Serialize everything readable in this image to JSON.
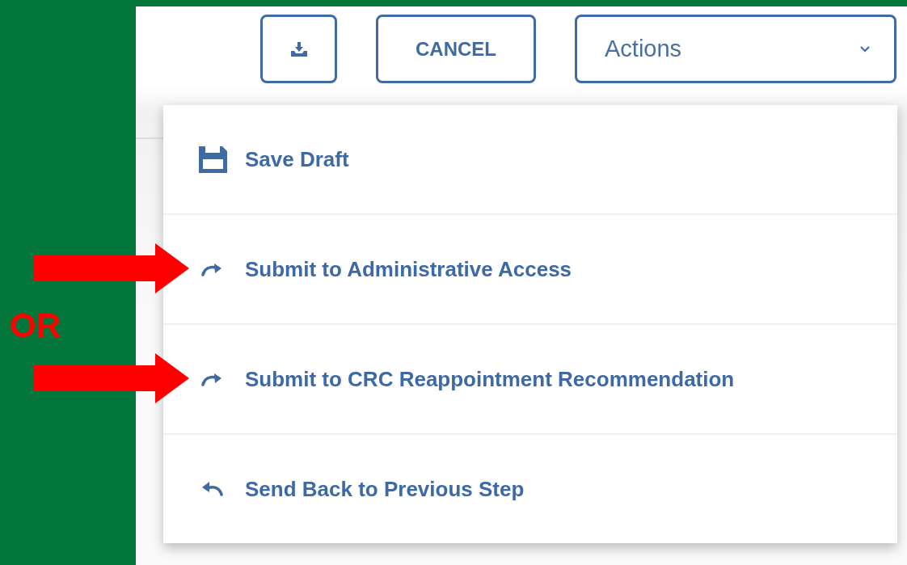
{
  "toolbar": {
    "cancel_label": "CANCEL",
    "actions_label": "Actions"
  },
  "menu": {
    "items": [
      {
        "kind": "save",
        "label": "Save Draft",
        "marked": false
      },
      {
        "kind": "forward",
        "label": "Submit to Administrative Access",
        "marked": true
      },
      {
        "kind": "forward",
        "label": "Submit to CRC Reappointment Recommendation",
        "marked": true
      },
      {
        "kind": "back",
        "label": "Send Back to Previous Step",
        "marked": false
      }
    ]
  },
  "annotation": {
    "text": "OR"
  }
}
